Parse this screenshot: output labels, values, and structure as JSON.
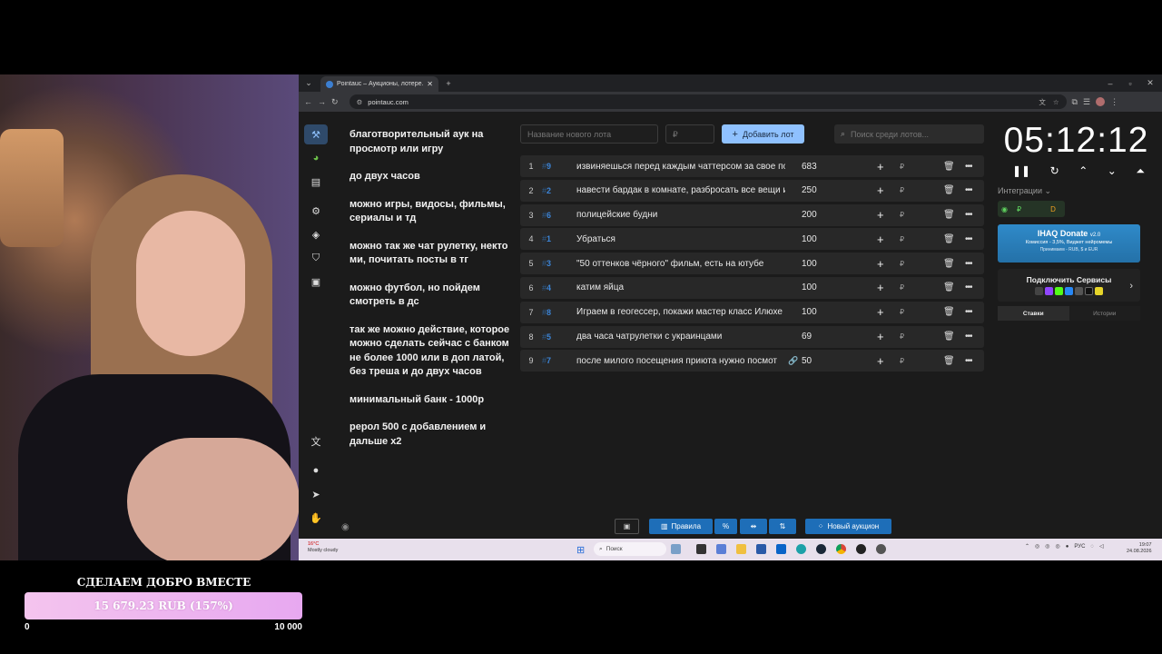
{
  "donation": {
    "title": "СДЕЛАЕМ ДОБРО ВМЕСТЕ",
    "amount": "15 679.23 RUB (157%)",
    "progress_percent": 100,
    "min": "0",
    "max": "10 000"
  },
  "browser": {
    "tab_title": "Pointauc – Аукционы, лотере...",
    "new_tab": "+",
    "url": "pointauc.com"
  },
  "rules": [
    "благотворительный аук на просмотр или игру",
    "до  двух часов",
    "можно игры, видосы, фильмы, сериалы и тд",
    "можно так же чат рулетку, некто ми, почитать посты в тг",
    "можно футбол, но пойдем смотреть в дс",
    "так же можно действие, которое можно сделать сейчас с банком не более 1000 или в доп латой, без треша  и до двух часов",
    "минимальный банк - 1000р",
    "рерол 500 с добавлением и дальше х2"
  ],
  "controls": {
    "lot_name_placeholder": "Название нового лота",
    "amount_placeholder": "₽",
    "add_lot": "Добавить лот",
    "search_placeholder": "Поиск среди лотов..."
  },
  "lots": [
    {
      "num": "1",
      "fast_id": "9",
      "name": "извиняешься перед каждым чаттерсом за свое пове",
      "amount": "683"
    },
    {
      "num": "2",
      "fast_id": "2",
      "name": "навести бардак в комнате, разбросать все вещи и м",
      "amount": "250"
    },
    {
      "num": "3",
      "fast_id": "6",
      "name": "полицейские будни",
      "amount": "200"
    },
    {
      "num": "4",
      "fast_id": "1",
      "name": "Убраться",
      "amount": "100"
    },
    {
      "num": "5",
      "fast_id": "3",
      "name": "\"50 оттенков чёрного\" фильм, есть на ютубе",
      "amount": "100"
    },
    {
      "num": "6",
      "fast_id": "4",
      "name": "катим яйца",
      "amount": "100"
    },
    {
      "num": "7",
      "fast_id": "8",
      "name": "Играем в геогессер, покажи мастер класс Илюхе М:",
      "amount": "100"
    },
    {
      "num": "8",
      "fast_id": "5",
      "name": "два часа чатрулетки с украинцами",
      "amount": "69"
    },
    {
      "num": "9",
      "fast_id": "7",
      "name": "после милого посещения приюта нужно посмот",
      "amount": "50",
      "has_link": true
    }
  ],
  "timer": {
    "value": "05:12:12"
  },
  "integrations": {
    "label": "Интеграции ⌄",
    "ihaq_title": "IHAQ Donate",
    "ihaq_version": "v2.0",
    "ihaq_line1": "Комиссия - 3,5%, Виджет нейромемы",
    "ihaq_line2": "Принимаем - RUB, $ и EUR",
    "services_title": "Подключить Сервисы"
  },
  "history_tabs": {
    "bets": "Ставки",
    "history": "Истории"
  },
  "toolbar": {
    "rules": "Правила",
    "new_auction": "Новый аукцион"
  },
  "taskbar": {
    "temp": "16°C",
    "weather": "Mostly cloudy",
    "search": "Поиск",
    "lang": "РУС",
    "time": "19:07",
    "date": "24.08.2026"
  },
  "colors": {
    "accent": "#8fc1ff",
    "toolbar_blue": "#1e6eb8",
    "fast_id": "#3c84d6"
  }
}
